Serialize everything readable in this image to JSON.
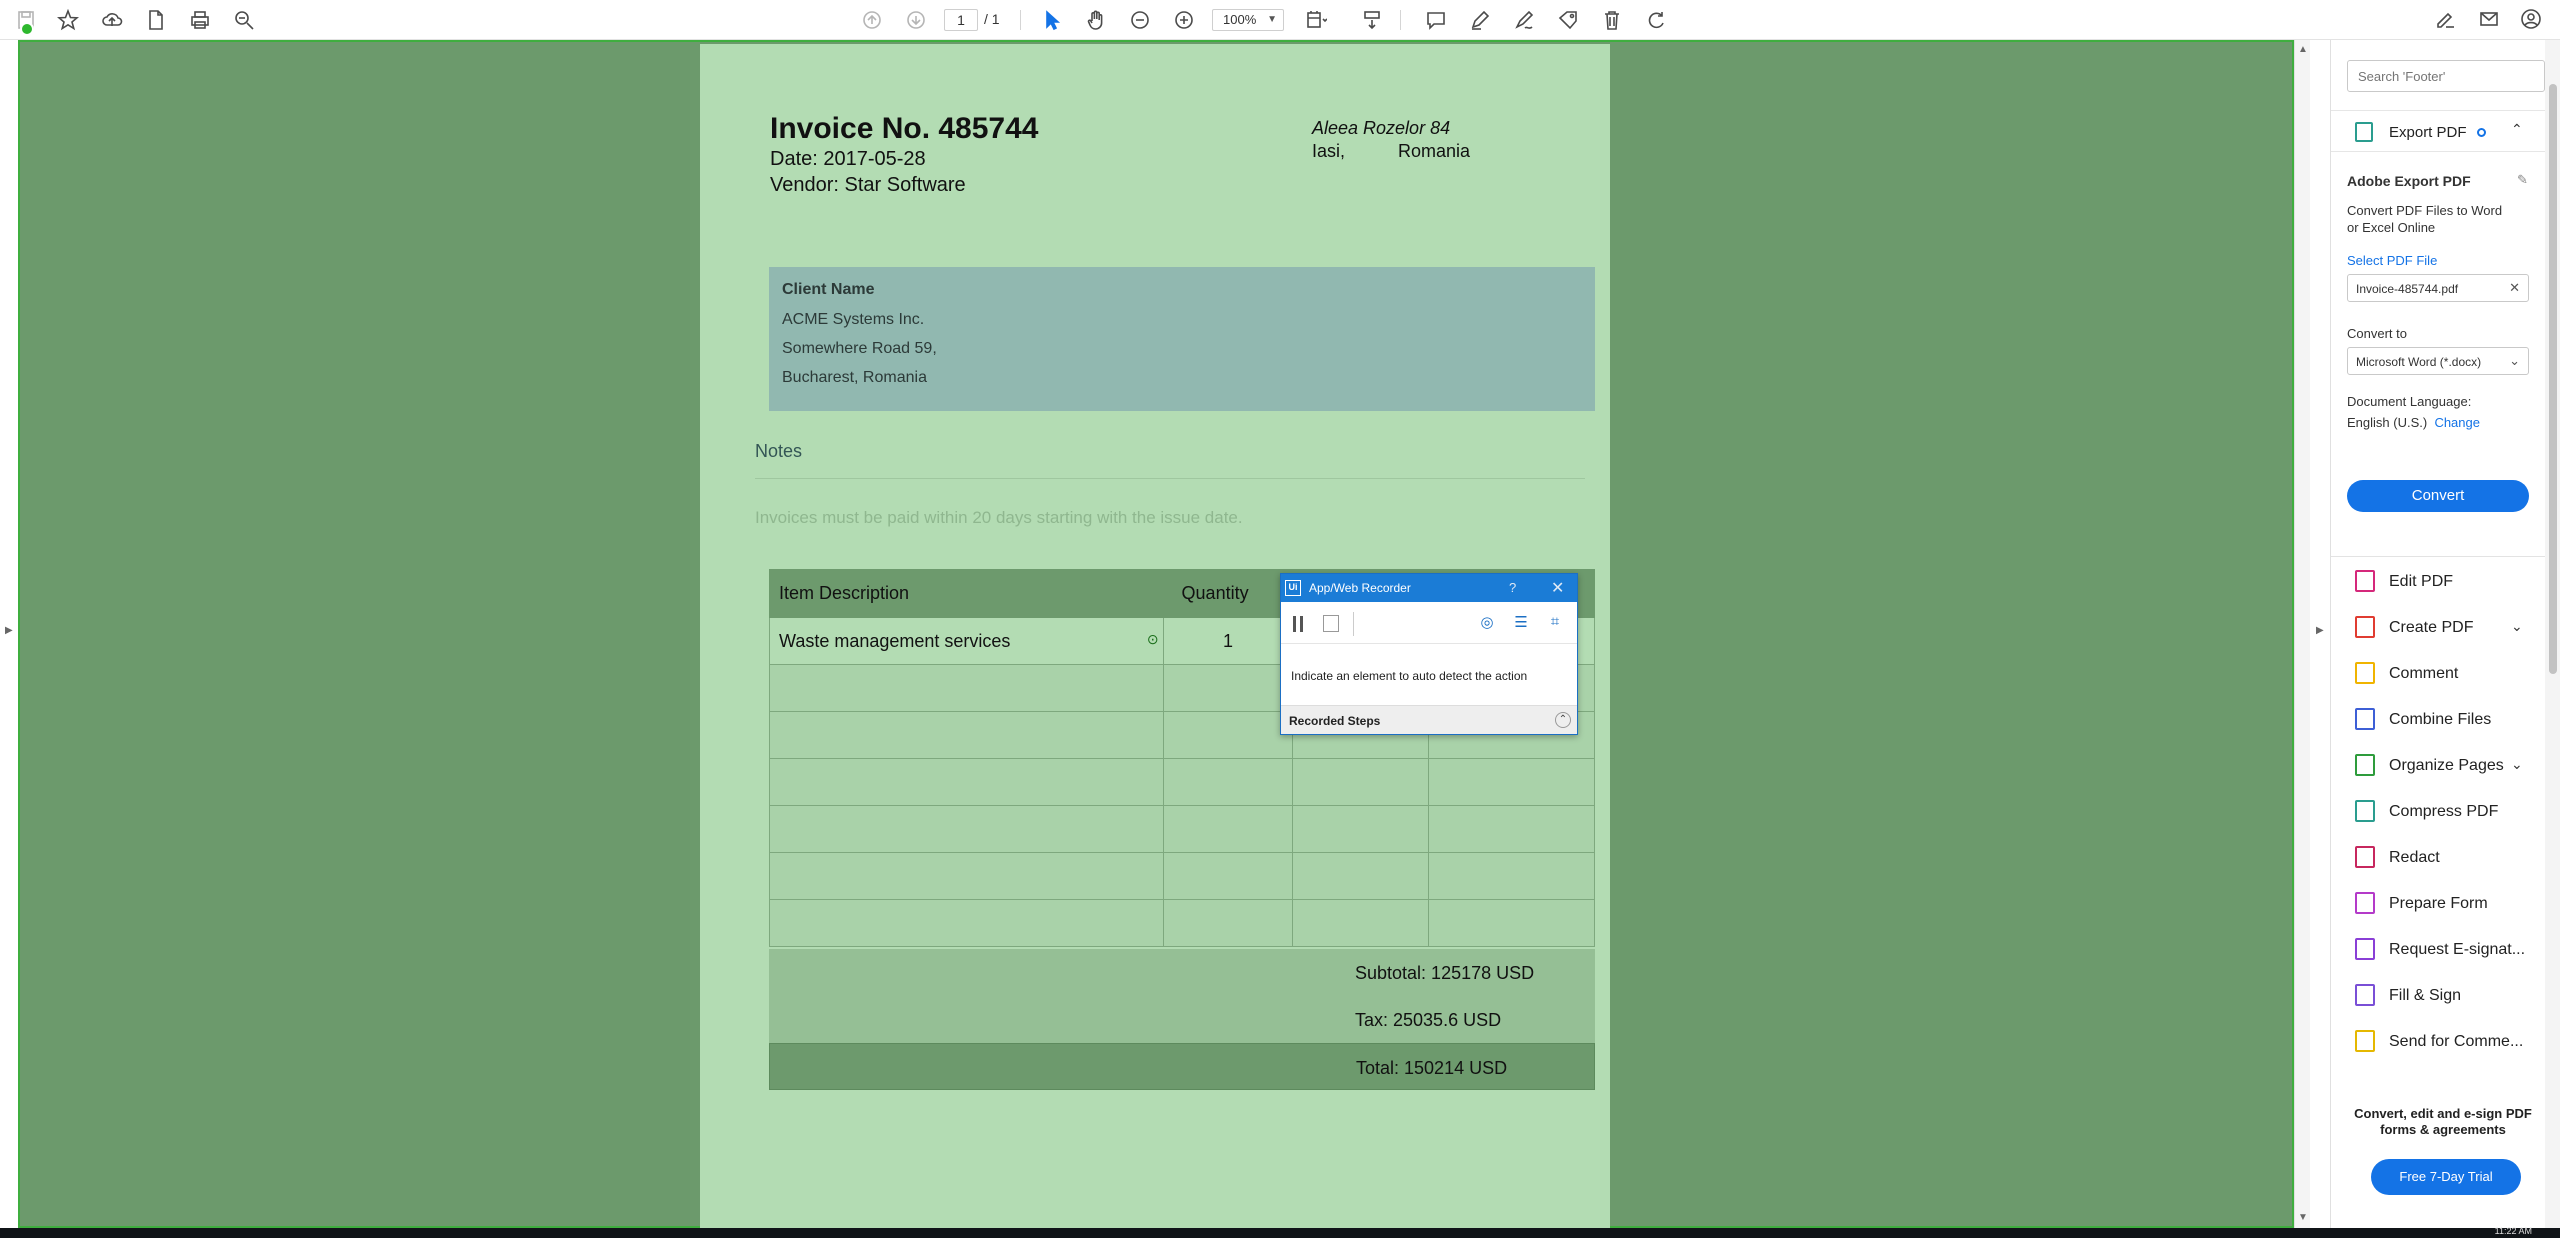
{
  "toolbar": {
    "page_current": "1",
    "page_total": "/ 1",
    "zoom": "100%"
  },
  "invoice": {
    "title": "Invoice No. 485744",
    "date": "Date: 2017-05-28",
    "vendor": "Vendor: Star Software",
    "address_street": "Aleea Rozelor 84",
    "address_city": "Iasi,",
    "address_country": "Romania"
  },
  "client": {
    "heading": "Client Name",
    "name": "ACME Systems Inc.",
    "street": "Somewhere Road 59,",
    "city": "Bucharest, Romania"
  },
  "notes": {
    "heading": "Notes",
    "text": "Invoices must be paid within 20 days starting with the issue date."
  },
  "table": {
    "headers": [
      "Item Description",
      "Quantity"
    ],
    "rows": [
      {
        "description": "Waste management services",
        "quantity": "1"
      }
    ]
  },
  "totals": {
    "subtotal": "Subtotal: 125178 USD",
    "tax": "Tax: 25035.6 USD",
    "total": "Total: 150214 USD"
  },
  "recorder": {
    "title": "App/Web Recorder",
    "help": "?",
    "message": "Indicate an element to auto detect the action",
    "steps_label": "Recorded Steps"
  },
  "panel": {
    "search_placeholder": "Search 'Footer'",
    "export_label": "Export PDF",
    "service_title": "Adobe Export PDF",
    "service_desc_1": "Convert PDF Files to Word",
    "service_desc_2": "or Excel Online",
    "select_file": "Select PDF File",
    "file_name": "Invoice-485744.pdf",
    "convert_to_label": "Convert to",
    "convert_to_value": "Microsoft Word (*.docx)",
    "doc_lang_label": "Document Language:",
    "doc_lang_value": "English (U.S.)",
    "change_link": "Change",
    "convert_button": "Convert",
    "tools": [
      {
        "label": "Edit PDF",
        "color": "#d5287b"
      },
      {
        "label": "Create PDF",
        "color": "#e03c31"
      },
      {
        "label": "Comment",
        "color": "#f0b400"
      },
      {
        "label": "Combine Files",
        "color": "#3d5fd6"
      },
      {
        "label": "Organize Pages",
        "color": "#2e9c3c"
      },
      {
        "label": "Compress PDF",
        "color": "#2a9d8f"
      },
      {
        "label": "Redact",
        "color": "#c7275e"
      },
      {
        "label": "Prepare Form",
        "color": "#b43ac9"
      },
      {
        "label": "Request E-signat...",
        "color": "#8a3fd6"
      },
      {
        "label": "Fill & Sign",
        "color": "#7a4fd6"
      },
      {
        "label": "Send for Comme...",
        "color": "#e5b800"
      }
    ],
    "promo_text": "Convert, edit and e-sign PDF forms & agreements",
    "trial_button": "Free 7-Day Trial"
  },
  "taskbar": {
    "time": "11:22 AM"
  }
}
